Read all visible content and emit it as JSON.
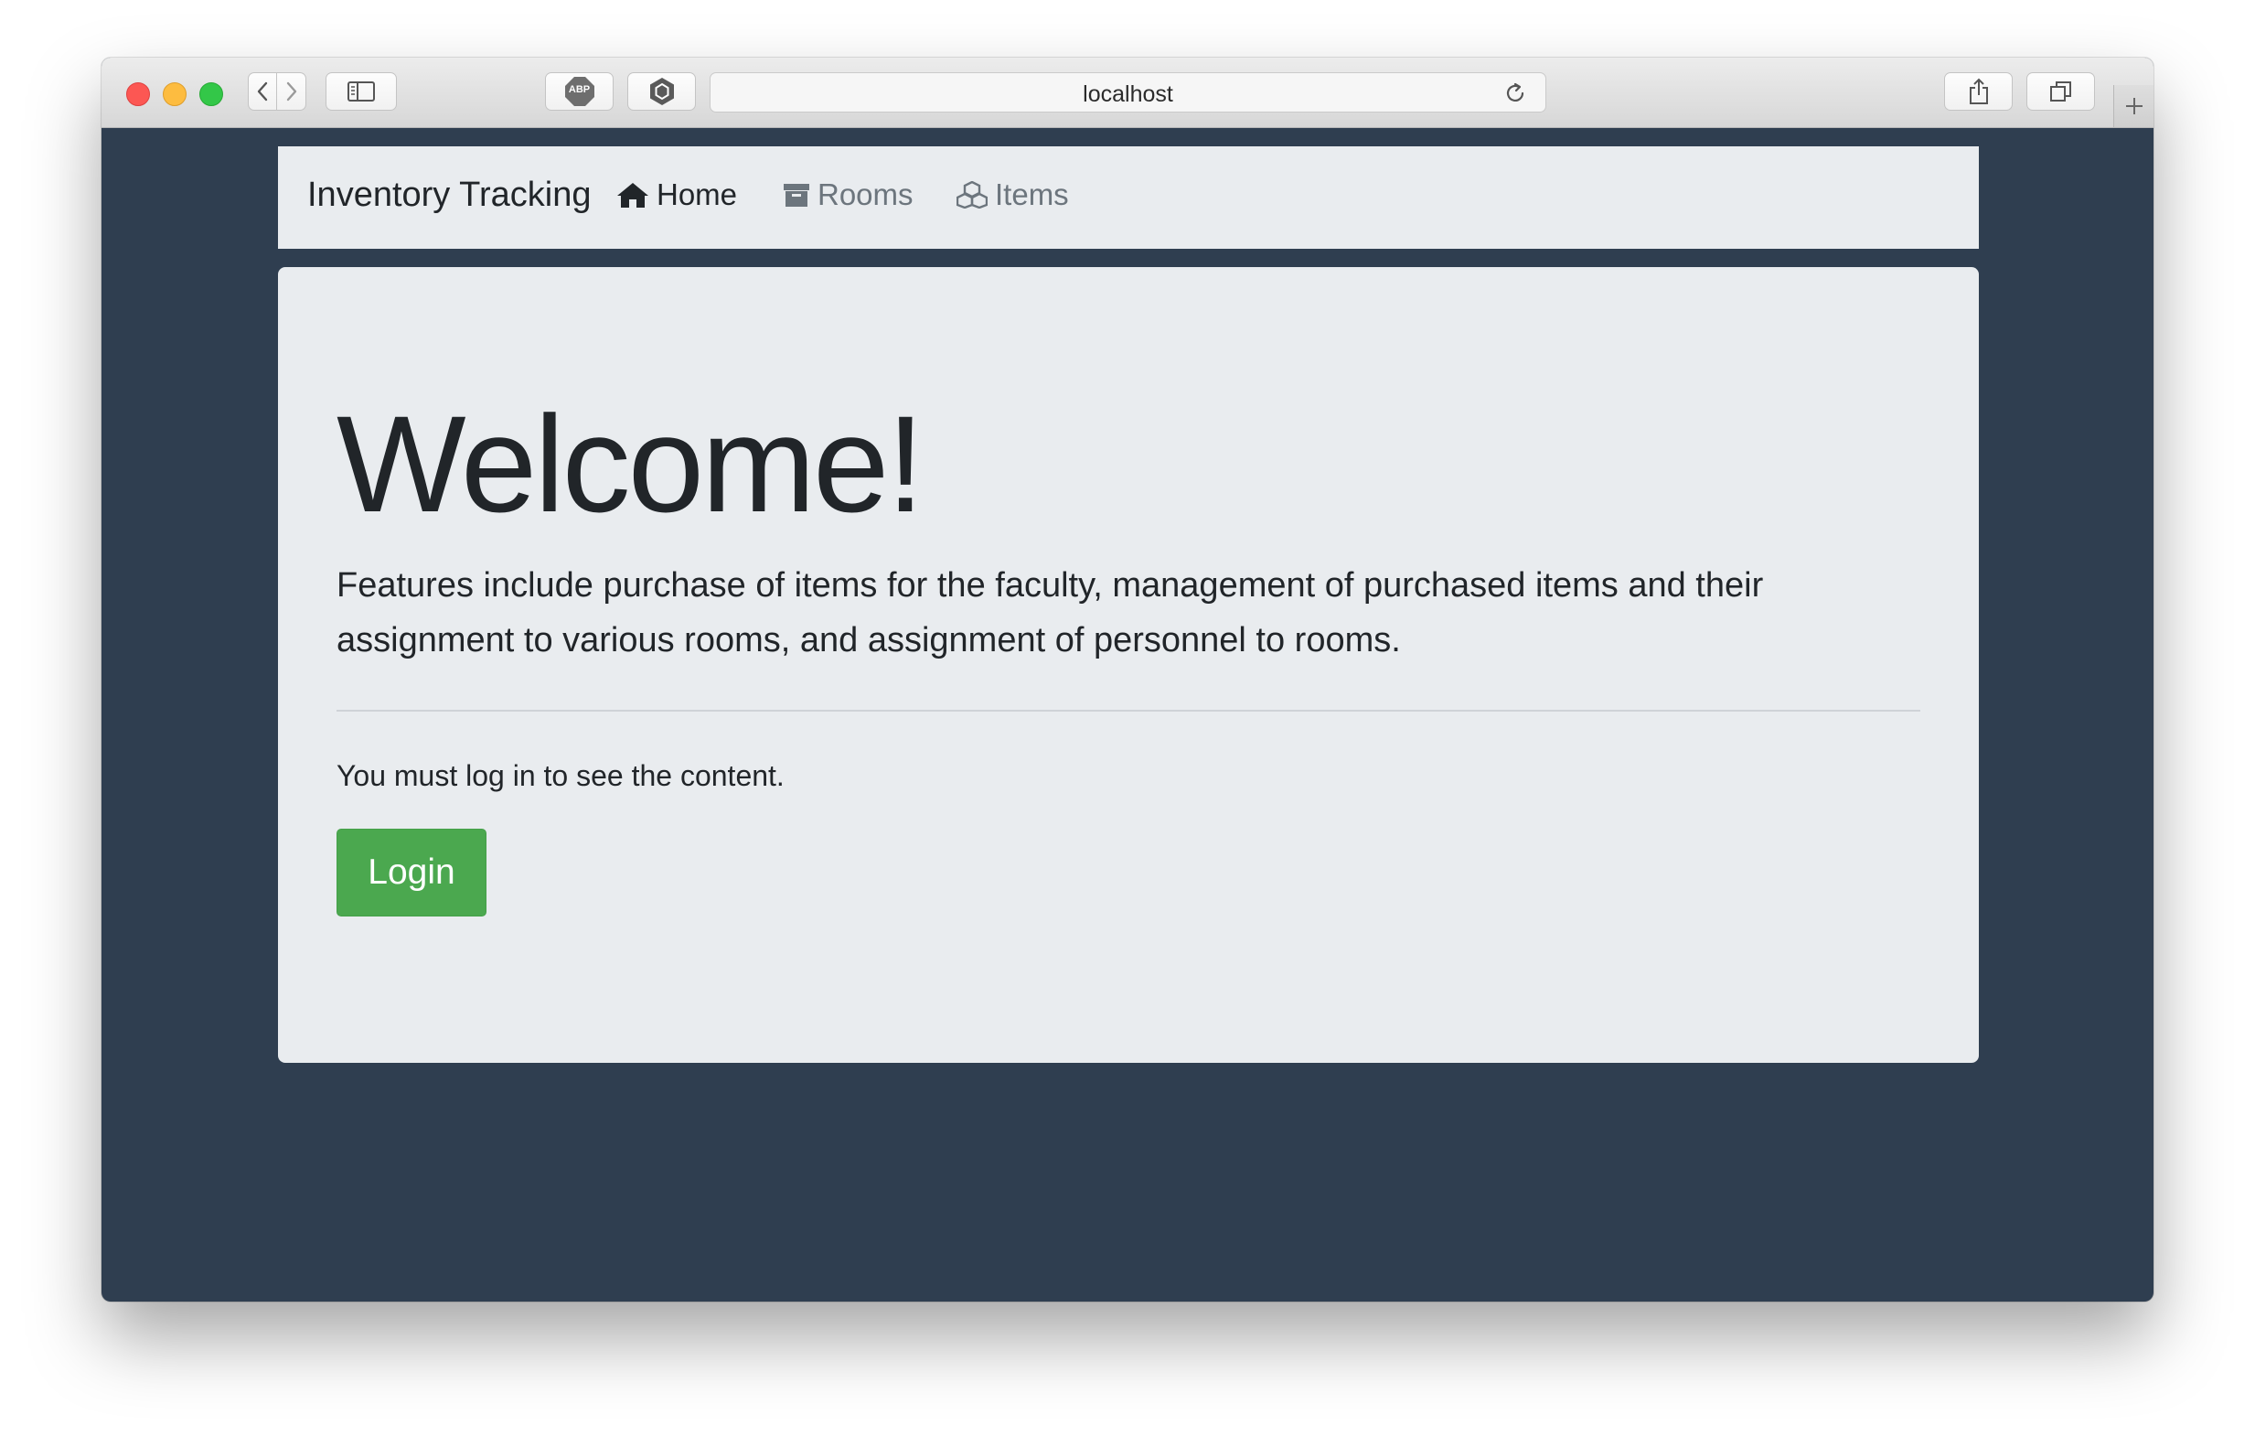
{
  "browser": {
    "url": "localhost",
    "toolbar_icons": [
      "back-icon",
      "forward-icon",
      "sidebar-icon",
      "adblock-icon",
      "extension-hexagon-icon",
      "reload-icon",
      "share-icon",
      "tabs-icon",
      "new-tab-icon"
    ],
    "adblock_label": "ABP"
  },
  "navbar": {
    "brand": "Inventory Tracking",
    "links": [
      {
        "label": "Home",
        "icon": "home-icon",
        "active": true
      },
      {
        "label": "Rooms",
        "icon": "archive-icon",
        "active": false
      },
      {
        "label": "Items",
        "icon": "cubes-icon",
        "active": false
      }
    ]
  },
  "jumbotron": {
    "title": "Welcome!",
    "lead": "Features include purchase of items for the faculty, management of purchased items and their assignment to various rooms, and assignment of personnel to rooms.",
    "message": "You must log in to see the content.",
    "login_label": "Login"
  },
  "colors": {
    "background": "#2f3e50",
    "panel": "#e9ecef",
    "login_button": "#4ba84f",
    "nav_inactive": "#6c757d"
  }
}
